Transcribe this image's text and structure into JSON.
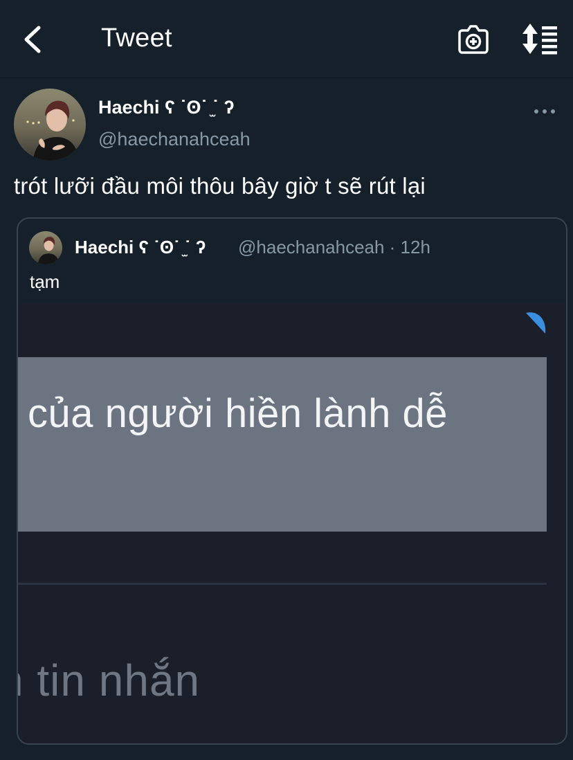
{
  "header": {
    "title": "Tweet"
  },
  "tweet": {
    "author_name": "Haechi ʕ ˙ʘ˙ ̫˙ ʔ",
    "author_handle": "@haechanahceah",
    "text": "trót lưỡi đầu môi thôu bây giờ t sẽ rút lại"
  },
  "quoted_tweet": {
    "author_name": "Haechi ʕ ˙ʘ˙ ̫˙ ʔ",
    "meta": "@haechanahceah · 12h",
    "text": "tạm",
    "media": {
      "highlight_text": "của người hiền lành dễ",
      "bottom_text": "n tin nhắn"
    }
  },
  "colors": {
    "background": "#15202b",
    "secondary_text": "#8899a6",
    "border": "#38444d",
    "media_highlight": "#6c7482",
    "accent_blue": "#3b8ee0"
  },
  "icons": [
    "back-arrow-icon",
    "add-photo-icon",
    "sort-icon",
    "more-icon"
  ]
}
